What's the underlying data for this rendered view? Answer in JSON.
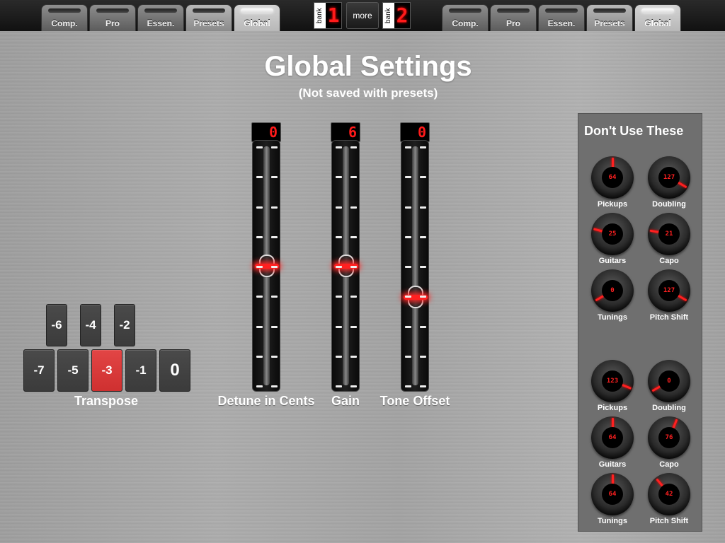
{
  "tabs_left": [
    {
      "label": "Comp.",
      "state": "normal"
    },
    {
      "label": "Pro",
      "state": "normal"
    },
    {
      "label": "Essen.",
      "state": "normal"
    },
    {
      "label": "Presets",
      "state": "preset"
    },
    {
      "label": "Global",
      "state": "active"
    }
  ],
  "tabs_right": [
    {
      "label": "Comp.",
      "state": "normal"
    },
    {
      "label": "Pro",
      "state": "normal"
    },
    {
      "label": "Essen.",
      "state": "normal"
    },
    {
      "label": "Presets",
      "state": "preset"
    },
    {
      "label": "Global",
      "state": "active"
    }
  ],
  "bank1": {
    "word": "bank",
    "number": "1"
  },
  "bank2": {
    "word": "bank",
    "number": "2"
  },
  "more_label": "more",
  "page": {
    "title": "Global Settings",
    "subtitle": "(Not saved with presets)"
  },
  "faders": [
    {
      "label": "Detune in Cents",
      "readout": "0",
      "level": 0.5
    },
    {
      "label": "Gain",
      "readout": "6",
      "level": 0.5
    },
    {
      "label": "Tone Offset",
      "readout": "0",
      "level": 0.37
    }
  ],
  "transpose": {
    "label": "Transpose",
    "top_row": [
      "-6",
      "-4",
      "-2"
    ],
    "bottom_row": [
      "-7",
      "-5",
      "-3",
      "-1",
      "0"
    ],
    "selected": "-3"
  },
  "panel": {
    "title": "Don't Use These",
    "group1": [
      {
        "label": "Pickups",
        "value": "64",
        "angle": 0
      },
      {
        "label": "Doubling",
        "value": "127",
        "angle": 120
      },
      {
        "label": "Guitars",
        "value": "25",
        "angle": -75
      },
      {
        "label": "Capo",
        "value": "21",
        "angle": -80
      },
      {
        "label": "Tunings",
        "value": "0",
        "angle": -120
      },
      {
        "label": "Pitch Shift",
        "value": "127",
        "angle": 120
      }
    ],
    "group2": [
      {
        "label": "Pickups",
        "value": "123",
        "angle": 112
      },
      {
        "label": "Doubling",
        "value": "0",
        "angle": -120
      },
      {
        "label": "Guitars",
        "value": "64",
        "angle": 0
      },
      {
        "label": "Capo",
        "value": "76",
        "angle": 22
      },
      {
        "label": "Tunings",
        "value": "64",
        "angle": 0
      },
      {
        "label": "Pitch Shift",
        "value": "42",
        "angle": -40
      }
    ]
  },
  "colors": {
    "accent_red": "#ff2020",
    "selected_button": "#d93a3a"
  }
}
